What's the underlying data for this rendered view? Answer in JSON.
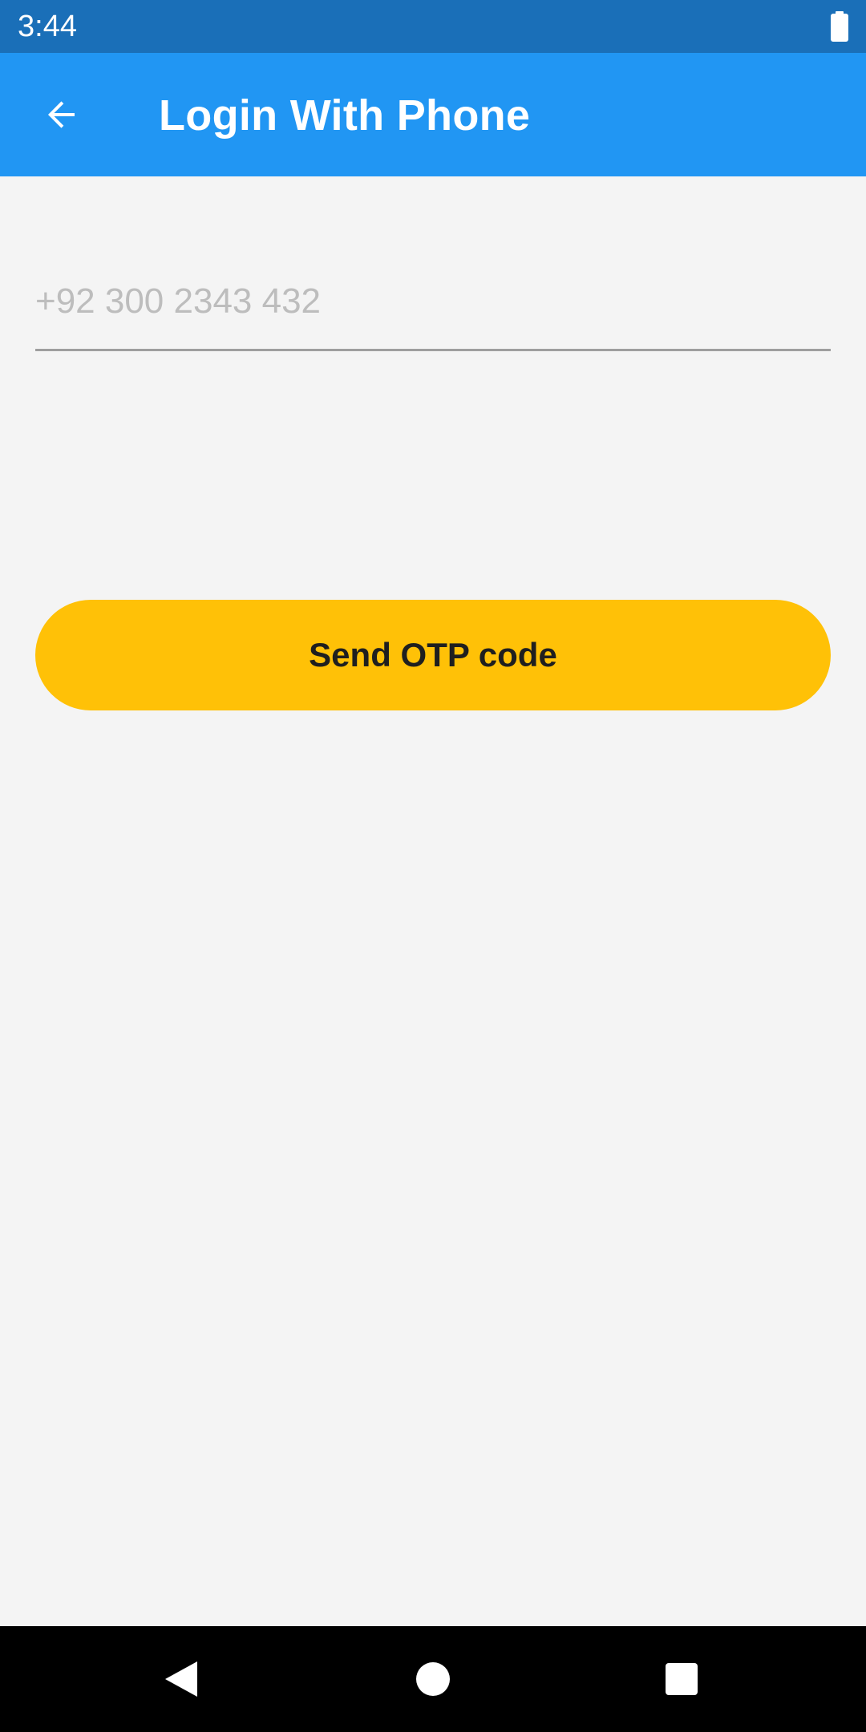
{
  "status_bar": {
    "time": "3:44",
    "battery_icon": "battery-full-icon"
  },
  "app_bar": {
    "back_icon": "arrow-back-icon",
    "title": "Login With Phone",
    "color": "#2196f3"
  },
  "form": {
    "phone_placeholder": "+92 300 2343 432",
    "phone_value": "",
    "send_label": "Send OTP code",
    "accent": "#ffc107"
  },
  "nav_bar": {
    "back": "nav-back-icon",
    "home": "nav-home-icon",
    "recents": "nav-recents-icon"
  }
}
